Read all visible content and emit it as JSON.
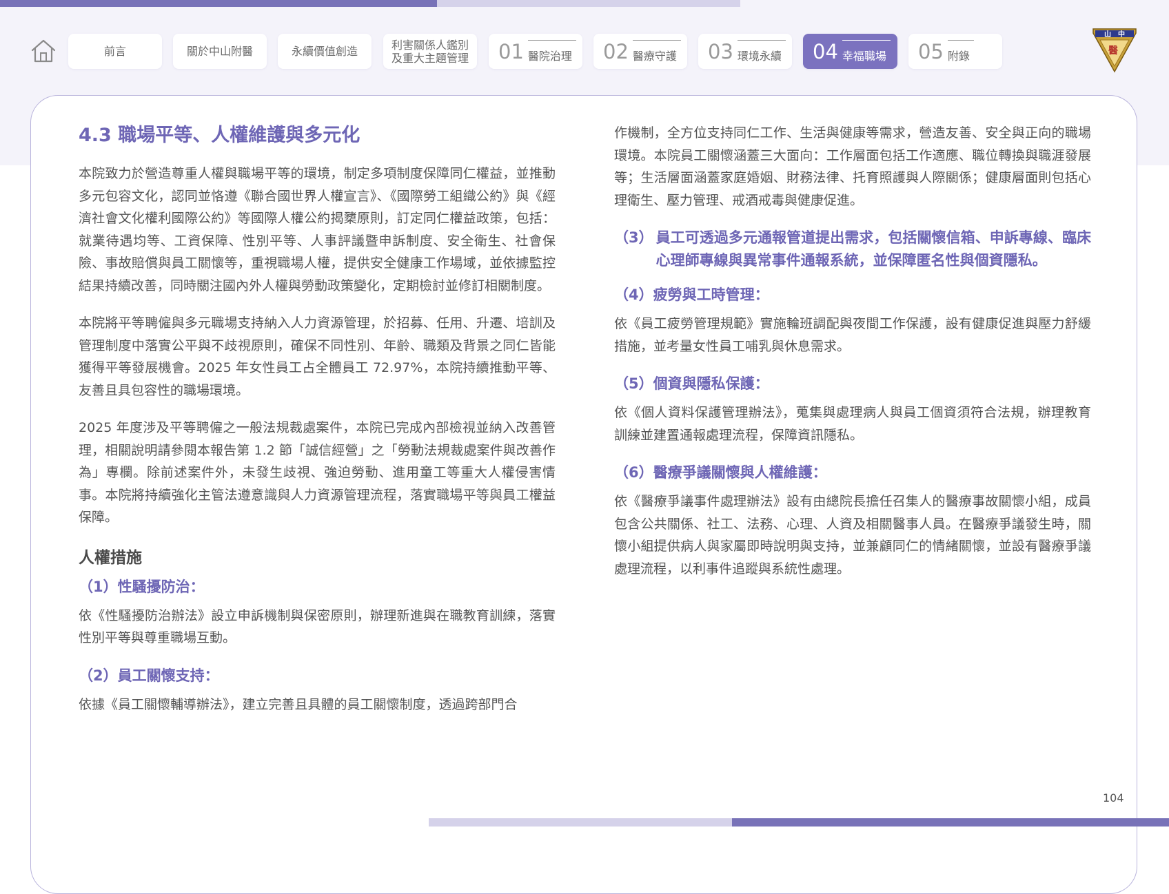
{
  "nav": {
    "tabs": [
      {
        "label": "前言"
      },
      {
        "label": "關於中山附醫"
      },
      {
        "label": "永續價值創造"
      },
      {
        "label": "利害關係人鑑別\n及重大主題管理"
      },
      {
        "num": "01",
        "label": "醫院治理"
      },
      {
        "num": "02",
        "label": "醫療守護"
      },
      {
        "num": "03",
        "label": "環境永續"
      },
      {
        "num": "04",
        "label": "幸福職場"
      },
      {
        "num": "05",
        "label": "附錄"
      }
    ],
    "logo_text": "山 中 醫"
  },
  "colors": {
    "accent": "#7b72bf",
    "heading": "#6e66b5",
    "band": "#f4f3fa"
  },
  "content": {
    "title": "4.3 職場平等、人權維護與多元化",
    "p1": "本院致力於營造尊重人權與職場平等的環境，制定多項制度保障同仁權益，並推動多元包容文化，認同並恪遵《聯合國世界人權宣言》、《國際勞工組織公約》與《經濟社會文化權利國際公約》等國際人權公約揭櫫原則，訂定同仁權益政策，包括：就業待遇均等、工資保障、性別平等、人事評議暨申訴制度、安全衛生、社會保險、事故賠償與員工關懷等，重視職場人權，提供安全健康工作場域，並依據監控結果持續改善，同時關注國內外人權與勞動政策變化，定期檢討並修訂相關制度。",
    "p2": "本院將平等聘僱與多元職場支持納入人力資源管理，於招募、任用、升遷、培訓及管理制度中落實公平與不歧視原則，確保不同性別、年齡、職類及背景之同仁皆能獲得平等發展機會。2025 年女性員工占全體員工 72.97%，本院持續推動平等、友善且具包容性的職場環境。",
    "p3": "2025 年度涉及平等聘僱之一般法規裁處案件，本院已完成內部檢視並納入改善管理，相關說明請參閱本報告第 1.2 節「誠信經營」之「勞動法規裁處案件與改善作為」專欄。除前述案件外，未發生歧視、強迫勞動、進用童工等重大人權侵害情事。本院將持續強化主管法遵意識與人力資源管理流程，落實職場平等與員工權益保障。",
    "section": "人權措施",
    "s1_head": "（1）性騷擾防治：",
    "s1_body": "依《性騷擾防治辦法》設立申訴機制與保密原則，辦理新進與在職教育訓練，落實性別平等與尊重職場互動。",
    "s2_head": "（2）員工關懷支持：",
    "s2_body": "依據《員工關懷輔導辦法》，建立完善且具體的員工關懷制度，透過跨部門合",
    "s2_body_cont": "作機制，全方位支持同仁工作、生活與健康等需求，營造友善、安全與正向的職場環境。本院員工關懷涵蓋三大面向：工作層面包括工作適應、職位轉換與職涯發展等；生活層面涵蓋家庭婚姻、財務法律、托育照護與人際關係；健康層面則包括心理衛生、壓力管理、戒酒戒毒與健康促進。",
    "s3_prefix": "（3）",
    "s3_head": "員工可透過多元通報管道提出需求，包括關懷信箱、申訴專線、臨床心理師專線與異常事件通報系統，並保障匿名性與個資隱私。",
    "s4_head": "（4）疲勞與工時管理：",
    "s4_body": "依《員工疲勞管理規範》實施輪班調配與夜間工作保護，設有健康促進與壓力舒緩措施，並考量女性員工哺乳與休息需求。",
    "s5_head": "（5）個資與隱私保護：",
    "s5_body": "依《個人資料保護管理辦法》，蒐集與處理病人與員工個資須符合法規，辦理教育訓練並建置通報處理流程，保障資訊隱私。",
    "s6_head": "（6）醫療爭議關懷與人權維護：",
    "s6_body": "依《醫療爭議事件處理辦法》設有由總院長擔任召集人的醫療事故關懷小組，成員包含公共關係、社工、法務、心理、人資及相關醫事人員。在醫療爭議發生時，關懷小組提供病人與家屬即時說明與支持，並兼顧同仁的情緒關懷，並設有醫療爭議處理流程，以利事件追蹤與系統性處理。"
  },
  "page_number": "104"
}
